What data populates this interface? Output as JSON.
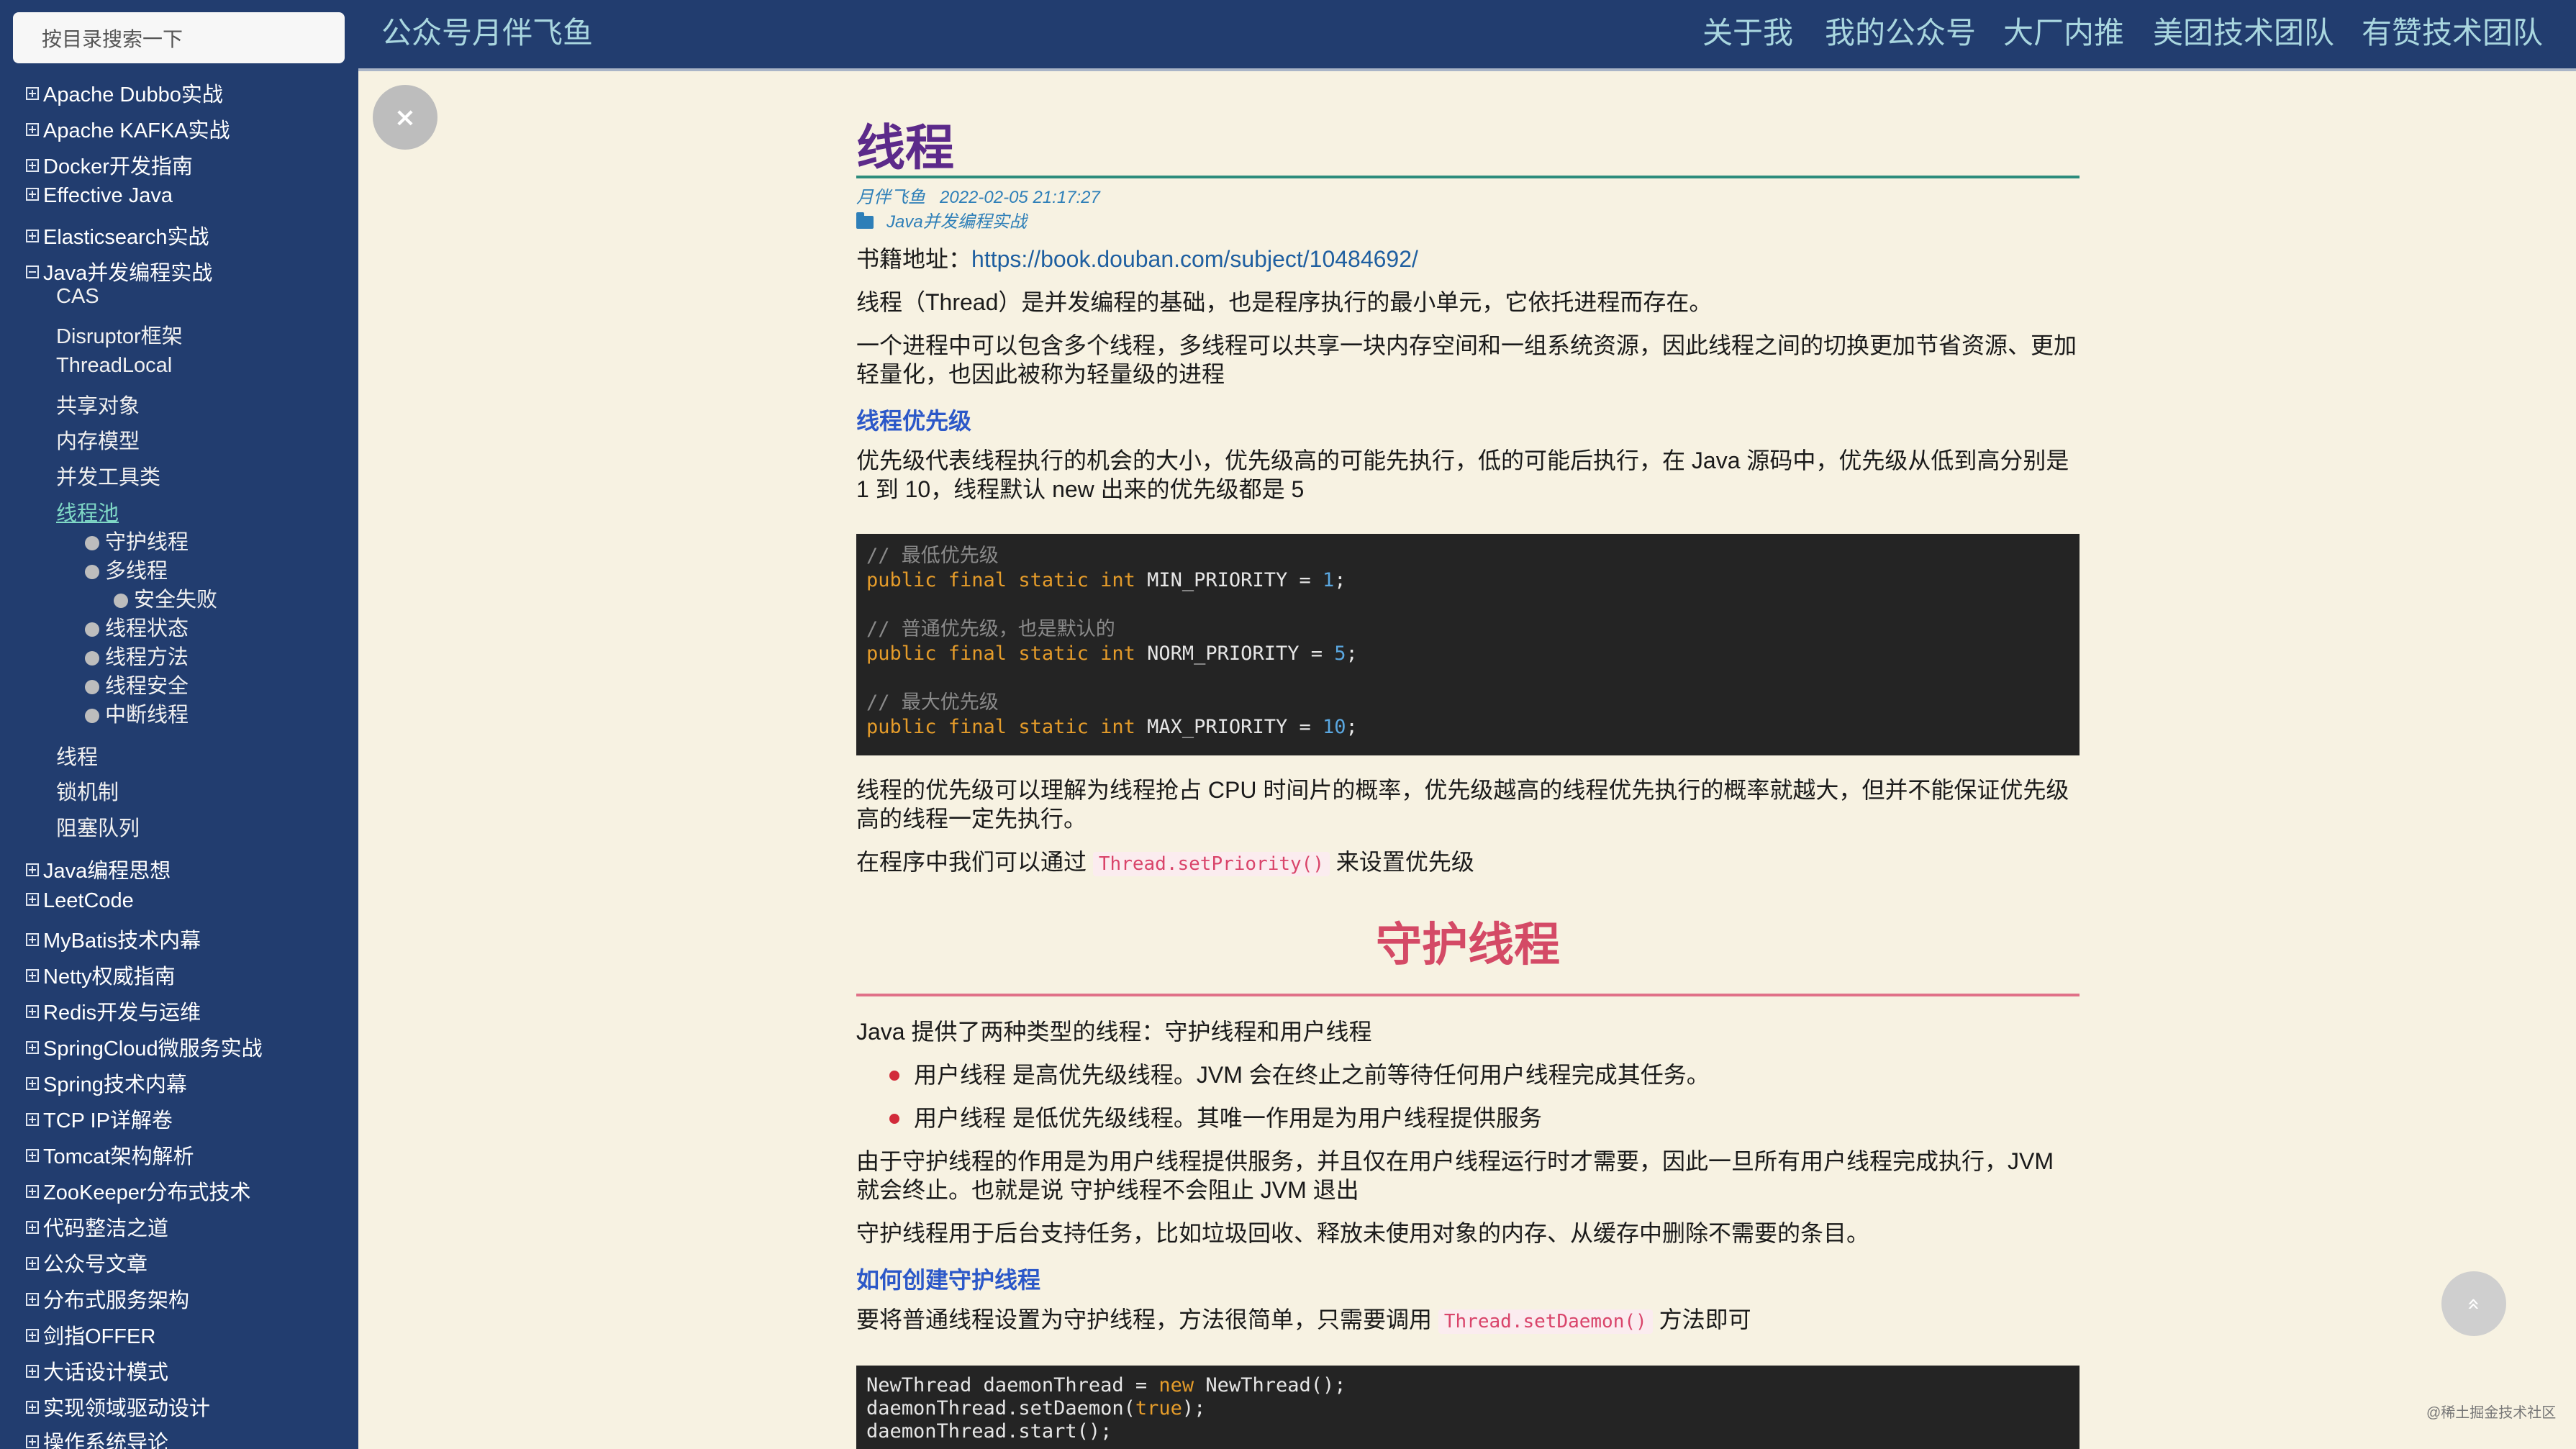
{
  "sidebar": {
    "search_placeholder": "按目录搜索一下",
    "categories": [
      "Apache Dubbo实战",
      "Apache KAFKA实战",
      "Docker开发指南",
      "Effective Java",
      "Elasticsearch实战",
      "Java并发编程实战",
      "Java编程思想",
      "LeetCode",
      "MyBatis技术内幕",
      "Netty权威指南",
      "Redis开发与运维",
      "SpringCloud微服务实战",
      "Spring技术内幕",
      "TCP IP详解卷",
      "Tomcat架构解析",
      "ZooKeeper分布式技术",
      "代码整洁之道",
      "公众号文章",
      "分布式服务架构",
      "剑指OFFER",
      "大话设计模式",
      "实现领域驱动设计",
      "操作系统导论"
    ],
    "java_concurrency_children": [
      "CAS",
      "Disruptor框架",
      "ThreadLocal",
      "共享对象",
      "内存模型",
      "并发工具类",
      "线程池"
    ],
    "thread_pool_toc": [
      "守护线程",
      "多线程",
      "安全失败",
      "线程状态",
      "线程方法",
      "线程安全",
      "中断线程"
    ],
    "java_concurrency_tail": [
      "线程",
      "锁机制",
      "阻塞队列"
    ]
  },
  "header": {
    "title": "公众号月伴飞鱼",
    "nav": [
      "关于我",
      "我的公众号",
      "大厂内推",
      "美团技术团队",
      "有赞技术团队"
    ]
  },
  "close_label": "×",
  "article": {
    "title": "线程",
    "author": "月伴飞鱼",
    "date": "2022-02-05 21:17:27",
    "category": "Java并发编程实战",
    "book_label": "书籍地址：",
    "book_url": "https://book.douban.com/subject/10484692/",
    "p1": "线程（Thread）是并发编程的基础，也是程序执行的最小单元，它依托进程而存在。",
    "p2": "一个进程中可以包含多个线程，多线程可以共享一块内存空间和一组系统资源，因此线程之间的切换更加节省资源、更加轻量化，也因此被称为轻量级的进程",
    "h_priority": "线程优先级",
    "p3": "优先级代表线程执行的机会的大小，优先级高的可能先执行，低的可能后执行，在 Java 源码中，优先级从低到高分别是 1 到 10，线程默认 new 出来的优先级都是 5",
    "code1": {
      "c1": "// 最低优先级",
      "c2": "// 普通优先级，也是默认的",
      "c3": "// 最大优先级",
      "kw": "public final static int",
      "n1": "MIN_PRIORITY = ",
      "v1": "1",
      "n2": "NORM_PRIORITY = ",
      "v2": "5",
      "n3": "MAX_PRIORITY = ",
      "v3": "10",
      "semi": ";"
    },
    "p4": "线程的优先级可以理解为线程抢占 CPU 时间片的概率，优先级越高的线程优先执行的概率就越大，但并不能保证优先级高的线程一定先执行。",
    "p5_pre": "在程序中我们可以通过 ",
    "p5_code": "Thread.setPriority()",
    "p5_post": " 来设置优先级",
    "h2": "守护线程",
    "p6": "Java 提供了两种类型的线程：守护线程和用户线程",
    "li1": "用户线程 是高优先级线程。JVM 会在终止之前等待任何用户线程完成其任务。",
    "li2": "用户线程 是低优先级线程。其唯一作用是为用户线程提供服务",
    "p7": "由于守护线程的作用是为用户线程提供服务，并且仅在用户线程运行时才需要，因此一旦所有用户线程完成执行，JVM 就会终止。也就是说 守护线程不会阻止 JVM 退出",
    "p8": "守护线程用于后台支持任务，比如垃圾回收、释放未使用对象的内存、从缓存中删除不需要的条目。",
    "h_create": "如何创建守护线程",
    "p9_pre": "要将普通线程设置为守护线程，方法很简单，只需要调用 ",
    "p9_code": "Thread.setDaemon()",
    "p9_post": " 方法即可",
    "code2": {
      "l1a": "NewThread daemonThread = ",
      "l1kw": "new",
      "l1b": " NewThread();",
      "l2a": "daemonThread.setDaemon(",
      "l2kw": "true",
      "l2b": ");",
      "l3": "daemonThread.start();"
    }
  },
  "back_to_top": "«",
  "watermark": "@稀土掘金技术社区"
}
